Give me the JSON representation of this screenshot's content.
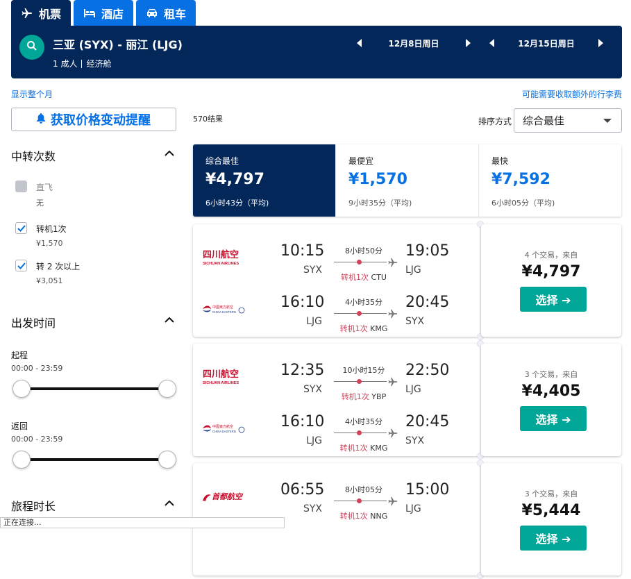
{
  "tabs": [
    {
      "label": "机票",
      "icon": "plane-icon",
      "active": true
    },
    {
      "label": "酒店",
      "icon": "bed-icon",
      "active": false
    },
    {
      "label": "租车",
      "icon": "car-icon",
      "active": false
    }
  ],
  "search": {
    "route": "三亚 (SYX) - 丽江 (LJG)",
    "passengers": "1 成人",
    "cabin": "经济舱",
    "outbound_date": "12月8日周日",
    "return_date": "12月15日周日"
  },
  "links": {
    "show_month": "显示整个月",
    "baggage_fees": "可能需要收取额外的行李费"
  },
  "price_alert": {
    "label": "获取价格变动提醒"
  },
  "filters": {
    "stops": {
      "title": "中转次数",
      "options": [
        {
          "label": "直飞",
          "sub": "无",
          "checked": false,
          "disabled": true
        },
        {
          "label": "转机1次",
          "sub": "¥1,570",
          "checked": true,
          "disabled": false
        },
        {
          "label": "转 2 次以上",
          "sub": "¥3,051",
          "checked": true,
          "disabled": false
        }
      ]
    },
    "departure_time": {
      "title": "出发时间",
      "outbound_label": "起程",
      "outbound_range": "00:00 - 23:59",
      "return_label": "返回",
      "return_range": "00:00 - 23:59"
    },
    "duration": {
      "title": "旅程时长"
    }
  },
  "results": {
    "count": "570结果",
    "sort_label": "排序方式",
    "sort_value": "综合最佳"
  },
  "sort_tabs": [
    {
      "title": "综合最佳",
      "price": "¥4,797",
      "duration": "6小时43分（平均)",
      "active": true
    },
    {
      "title": "最便宜",
      "price": "¥1,570",
      "duration": "9小时35分（平均)",
      "active": false
    },
    {
      "title": "最快",
      "price": "¥7,592",
      "duration": "6小时05分（平均)",
      "active": false
    }
  ],
  "itineraries": [
    {
      "deals": "4 个交易，来自",
      "price": "¥4,797",
      "select_label": "选择 ➔",
      "legs": [
        {
          "airline": "sichuan",
          "dep_time": "10:15",
          "dep_code": "SYX",
          "arr_time": "19:05",
          "arr_code": "LJG",
          "duration": "8小时50分",
          "stops": "转机1次",
          "via": "CTU"
        },
        {
          "airline": "eastern",
          "dep_time": "16:10",
          "dep_code": "LJG",
          "arr_time": "20:45",
          "arr_code": "SYX",
          "duration": "4小时35分",
          "stops": "转机1次",
          "via": "KMG"
        }
      ]
    },
    {
      "deals": "3 个交易，来自",
      "price": "¥4,405",
      "select_label": "选择 ➔",
      "legs": [
        {
          "airline": "sichuan",
          "dep_time": "12:35",
          "dep_code": "SYX",
          "arr_time": "22:50",
          "arr_code": "LJG",
          "duration": "10小时15分",
          "stops": "转机1次",
          "via": "YBP"
        },
        {
          "airline": "eastern",
          "dep_time": "16:10",
          "dep_code": "LJG",
          "arr_time": "20:45",
          "arr_code": "SYX",
          "duration": "4小时35分",
          "stops": "转机1次",
          "via": "KMG"
        }
      ]
    },
    {
      "deals": "3 个交易，来自",
      "price": "¥5,444",
      "select_label": "选择 ➔",
      "legs": [
        {
          "airline": "capital",
          "dep_time": "06:55",
          "dep_code": "SYX",
          "arr_time": "15:00",
          "arr_code": "LJG",
          "duration": "8小时05分",
          "stops": "转机1次",
          "via": "NNG"
        }
      ]
    }
  ],
  "airline_logos": {
    "sichuan": {
      "cn": "四川航空",
      "en": "SICHUAN AIRLINES",
      "color": "#c8102e"
    },
    "eastern": {
      "cn": "中國東方航空",
      "en": "CHINA EASTERN",
      "color": "#c8102e"
    },
    "capital": {
      "cn": "首都航空",
      "en": "",
      "color": "#c8102e"
    }
  },
  "status_bar": "正在连接..."
}
